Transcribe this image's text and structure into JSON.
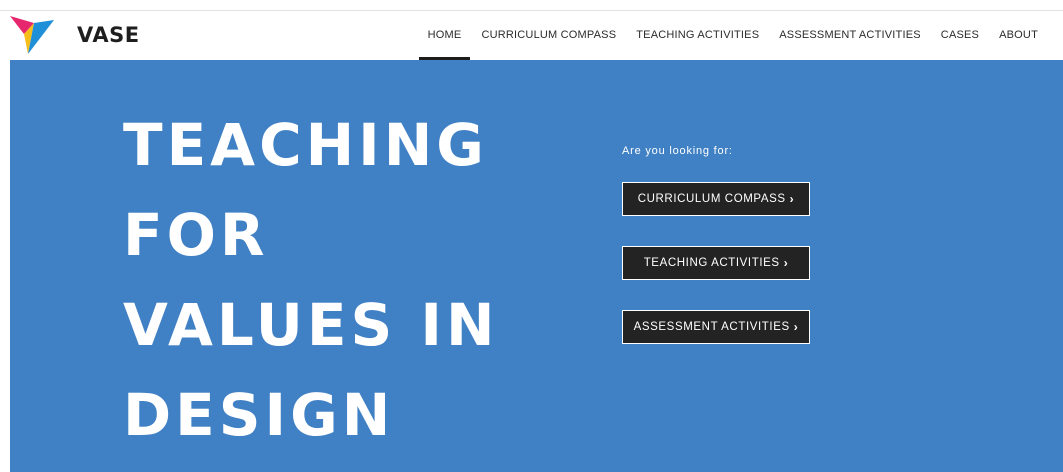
{
  "header": {
    "brand": "VASE",
    "logo_icon": "vase-tri-color-logo-icon",
    "nav": [
      {
        "label": "HOME",
        "active": true
      },
      {
        "label": "CURRICULUM COMPASS"
      },
      {
        "label": "TEACHING ACTIVITIES"
      },
      {
        "label": "ASSESSMENT ACTIVITIES"
      },
      {
        "label": "CASES"
      },
      {
        "label": "ABOUT"
      }
    ]
  },
  "hero": {
    "title_lines": [
      "TEACHING",
      "FOR",
      "VALUES IN",
      "DESIGN"
    ],
    "prompt": "Are you looking for:",
    "buttons": [
      {
        "label": "CURRICULUM COMPASS",
        "icon": "chevron-right-icon"
      },
      {
        "label": "TEACHING ACTIVITIES",
        "icon": "chevron-right-icon"
      },
      {
        "label": "ASSESSMENT ACTIVITIES",
        "icon": "chevron-right-icon"
      }
    ]
  },
  "colors": {
    "hero_background": "#4080c4",
    "button_background": "#232323",
    "logo_magenta": "#e6276d",
    "logo_yellow": "#f6be1a",
    "logo_blue": "#1f8fd8"
  }
}
